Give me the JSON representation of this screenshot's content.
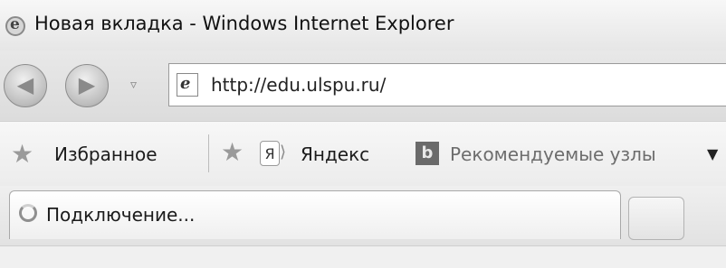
{
  "window": {
    "title": "Новая вкладка - Windows Internet Explorer",
    "icon": "ie-logo-icon"
  },
  "navigation": {
    "back_icon": "back-arrow-icon",
    "forward_icon": "forward-arrow-icon",
    "dropdown_icon": "recent-pages-dropdown-icon",
    "address": {
      "url": "http://edu.ulspu.ru/",
      "icon": "page-icon"
    }
  },
  "favorites_bar": {
    "favorites_label": "Избранное",
    "favorites_icon": "favorites-star-icon",
    "add_icon": "add-favorite-icon",
    "items": [
      {
        "label": "Яндекс",
        "icon": "yandex-icon"
      },
      {
        "label": "Рекомендуемые узлы",
        "icon": "bing-icon",
        "has_dropdown": true
      }
    ]
  },
  "tabs": {
    "active": {
      "label": "Подключение...",
      "icon": "loading-icon"
    },
    "new_tab_icon": "new-tab-icon"
  },
  "colors": {
    "scheme": "grayscale"
  }
}
